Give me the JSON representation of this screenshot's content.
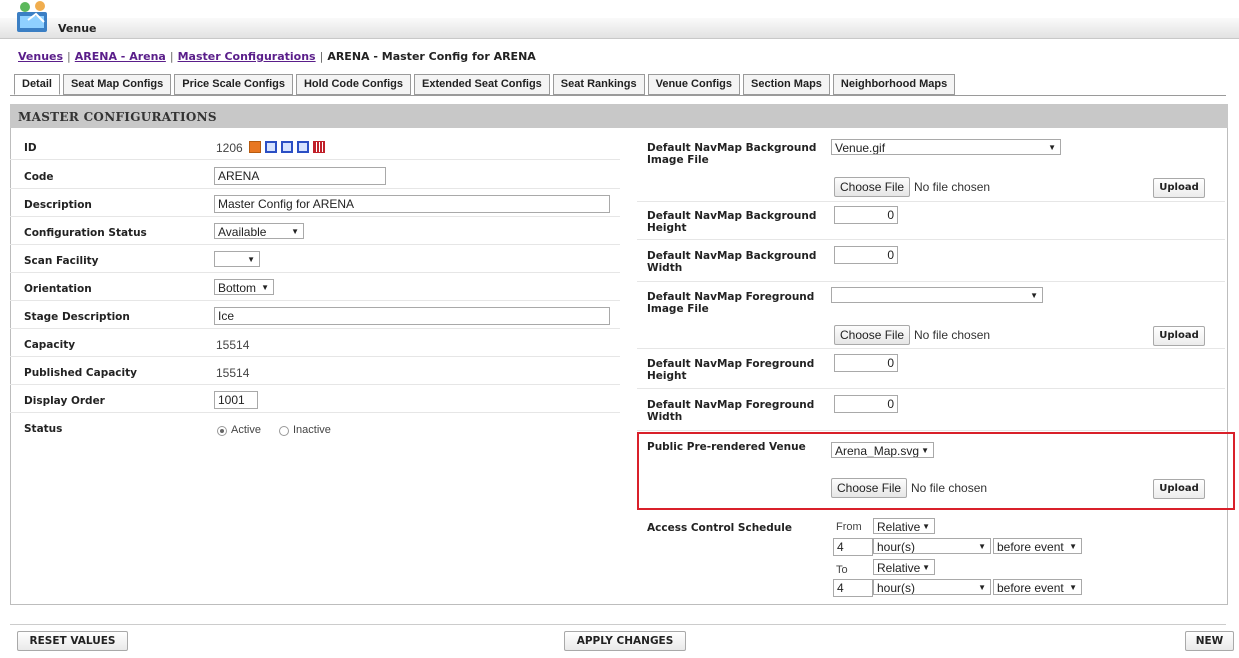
{
  "app": {
    "title": "Venue"
  },
  "breadcrumb": {
    "items": [
      "Venues",
      "ARENA - Arena",
      "Master Configurations"
    ],
    "current": "ARENA - Master Config for ARENA",
    "separator": "|"
  },
  "tabs": [
    "Detail",
    "Seat Map Configs",
    "Price Scale Configs",
    "Hold Code Configs",
    "Extended Seat Configs",
    "Seat Rankings",
    "Venue Configs",
    "Section Maps",
    "Neighborhood Maps"
  ],
  "panel": {
    "title": "MASTER CONFIGURATIONS"
  },
  "left": {
    "id_label": "ID",
    "id_value": "1206",
    "code_label": "Code",
    "code_value": "ARENA",
    "description_label": "Description",
    "description_value": "Master Config for ARENA",
    "config_status_label": "Configuration Status",
    "config_status_value": "Available",
    "scan_facility_label": "Scan Facility",
    "scan_facility_value": "",
    "orientation_label": "Orientation",
    "orientation_value": "Bottom",
    "stage_label": "Stage Description",
    "stage_value": "Ice",
    "capacity_label": "Capacity",
    "capacity_value": "15514",
    "published_label": "Published Capacity",
    "published_value": "15514",
    "display_order_label": "Display Order",
    "display_order_value": "1001",
    "status_label": "Status",
    "status_active": "Active",
    "status_inactive": "Inactive"
  },
  "right": {
    "bg_image_label": "Default NavMap Background Image File",
    "bg_image_value": "Venue.gif",
    "choose_file": "Choose File",
    "no_file": "No file chosen",
    "upload": "Upload",
    "bg_height_label": "Default NavMap Background Height",
    "bg_height_value": "0",
    "bg_width_label": "Default NavMap Background Width",
    "bg_width_value": "0",
    "fg_image_label": "Default NavMap Foreground Image File",
    "fg_image_value": "",
    "fg_height_label": "Default NavMap Foreground Height",
    "fg_height_value": "0",
    "fg_width_label": "Default NavMap Foreground Width",
    "fg_width_value": "0",
    "prerendered_label": "Public Pre-rendered Venue",
    "prerendered_value": "Arena_Map.svg",
    "acs_label": "Access Control Schedule",
    "from_label": "From",
    "to_label": "To",
    "from_mode": "Relative",
    "from_amount": "4",
    "from_unit": "hour(s)",
    "from_rel": "before event",
    "to_mode": "Relative",
    "to_amount": "4",
    "to_unit": "hour(s)",
    "to_rel": "before event"
  },
  "footer": {
    "reset": "RESET VALUES",
    "apply": "APPLY CHANGES",
    "new": "NEW"
  },
  "colors": {
    "highlight": "#d9202a",
    "link": "#5a1e8a",
    "header_bg": "#c8c8c8"
  }
}
